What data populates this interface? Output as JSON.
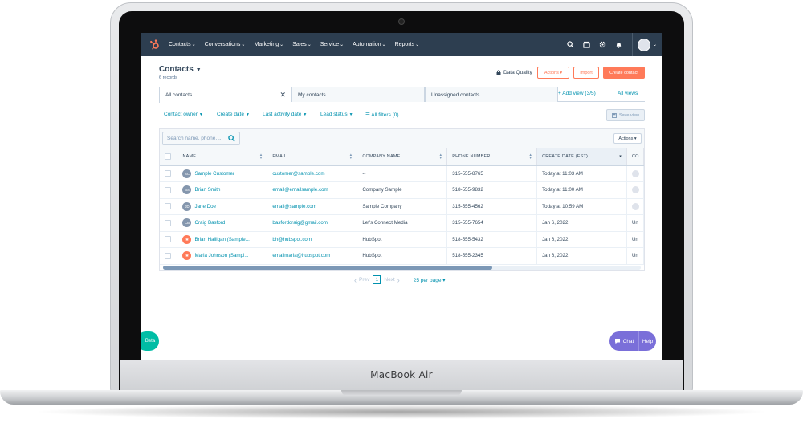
{
  "device": {
    "brand": "MacBook Air"
  },
  "nav": {
    "items": [
      {
        "label": "Contacts"
      },
      {
        "label": "Conversations"
      },
      {
        "label": "Marketing"
      },
      {
        "label": "Sales"
      },
      {
        "label": "Service"
      },
      {
        "label": "Automation"
      },
      {
        "label": "Reports"
      }
    ],
    "caret": "⌄"
  },
  "header": {
    "title": "Contacts",
    "records": "6 records",
    "data_quality": "Data Quality",
    "actions_btn": "Actions ▾",
    "import_btn": "Import",
    "create_btn": "Create contact"
  },
  "tabs": [
    {
      "label": "All contacts",
      "close": "✕"
    },
    {
      "label": "My contacts"
    },
    {
      "label": "Unassigned contacts"
    }
  ],
  "views": {
    "add_view": "+  Add view (3/5)",
    "all_views": "All views"
  },
  "filters": [
    {
      "label": "Contact owner"
    },
    {
      "label": "Create date"
    },
    {
      "label": "Last activity date"
    },
    {
      "label": "Lead status"
    }
  ],
  "all_filters": "☰  All filters (0)",
  "save_view": "Save view",
  "table": {
    "search_placeholder": "Search name, phone, ...",
    "actions": "Actions ▾",
    "headers": [
      "NAME",
      "EMAIL",
      "COMPANY NAME",
      "PHONE NUMBER",
      "CREATE DATE (EST)",
      "CO"
    ],
    "rows": [
      {
        "initials": "SC",
        "avatar": "grey",
        "name": "Sample Customer",
        "email": "customer@sample.com",
        "company": "--",
        "phone": "315-555-8765",
        "date": "Today at 11:03 AM",
        "owner": ""
      },
      {
        "initials": "BS",
        "avatar": "grey",
        "name": "Brian Smith",
        "email": "email@emailsample.com",
        "company": "Company Sample",
        "phone": "518-555-9832",
        "date": "Today at 11:00 AM",
        "owner": ""
      },
      {
        "initials": "JD",
        "avatar": "grey",
        "name": "Jane Doe",
        "email": "email@sample.com",
        "company": "Sample Company",
        "phone": "315-555-4562",
        "date": "Today at 10:59 AM",
        "owner": ""
      },
      {
        "initials": "CB",
        "avatar": "grey",
        "name": "Craig Basford",
        "email": "basfordcraig@gmail.com",
        "company": "Let's Connect Media",
        "phone": "315-555-7654",
        "date": "Jan 6, 2022",
        "owner": "Un"
      },
      {
        "initials": "",
        "avatar": "orange",
        "name": "Brian Halligan (Sample...",
        "email": "bh@hubspot.com",
        "company": "HubSpot",
        "phone": "518-555-5432",
        "date": "Jan 6, 2022",
        "owner": "Un"
      },
      {
        "initials": "",
        "avatar": "orange",
        "name": "Maria Johnson (Sampl...",
        "email": "emailmaria@hubspot.com",
        "company": "HubSpot",
        "phone": "518-555-2345",
        "date": "Jan 6, 2022",
        "owner": "Un"
      }
    ]
  },
  "pager": {
    "prev": "Prev",
    "page": "1",
    "next": "Next",
    "per_page": "25 per page ▾"
  },
  "widgets": {
    "beta": "Beta",
    "chat": "Chat",
    "help": "Help"
  },
  "colors": {
    "nav_bg": "#2d3e50",
    "accent": "#ff7a59",
    "link": "#0091ae",
    "chat": "#7a6fd9",
    "beta": "#00bda5"
  }
}
